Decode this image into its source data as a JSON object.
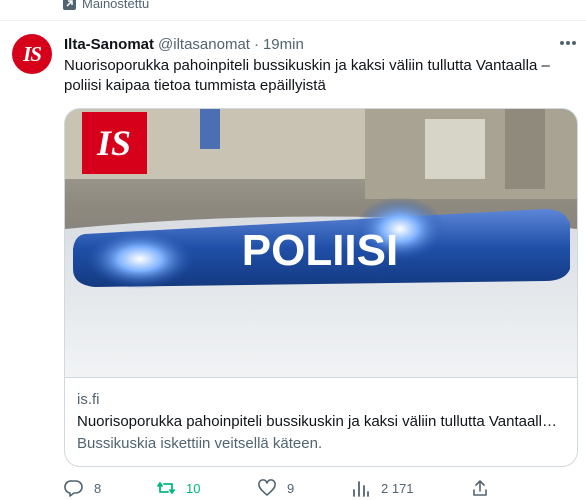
{
  "promo": {
    "label": "Mainostettu"
  },
  "tweet": {
    "author_name": "Ilta-Sanomat",
    "handle": "@iltasanomat",
    "separator": "·",
    "time": "19min",
    "avatar_text": "IS",
    "text": "Nuorisoporukka pahoinpiteli bussikuskin ja kaksi väliin tullutta Vantaalla – poliisi kaipaa tietoa tummista epäillyistä"
  },
  "card": {
    "image_logo_text": "IS",
    "image_sign_text": "POLIISI",
    "domain": "is.fi",
    "title": "Nuorisoporukka pahoinpiteli bussikuskin ja kaksi väliin tullutta Vantaalla – poliisi kaipaa tietoa tummista epäillyistä",
    "description": "Bussikuskia iskettiin veitsellä käteen."
  },
  "actions": {
    "replies": "8",
    "retweets": "10",
    "likes": "9",
    "views": "2 171"
  },
  "colors": {
    "brand_red": "#d7001b",
    "retweet_green": "#00ba7c",
    "secondary_text": "#536471",
    "police_blue": "#1f4fa8"
  },
  "icons": [
    "promoted-icon",
    "more-icon",
    "reply-icon",
    "retweet-icon",
    "like-icon",
    "views-icon",
    "share-icon"
  ]
}
